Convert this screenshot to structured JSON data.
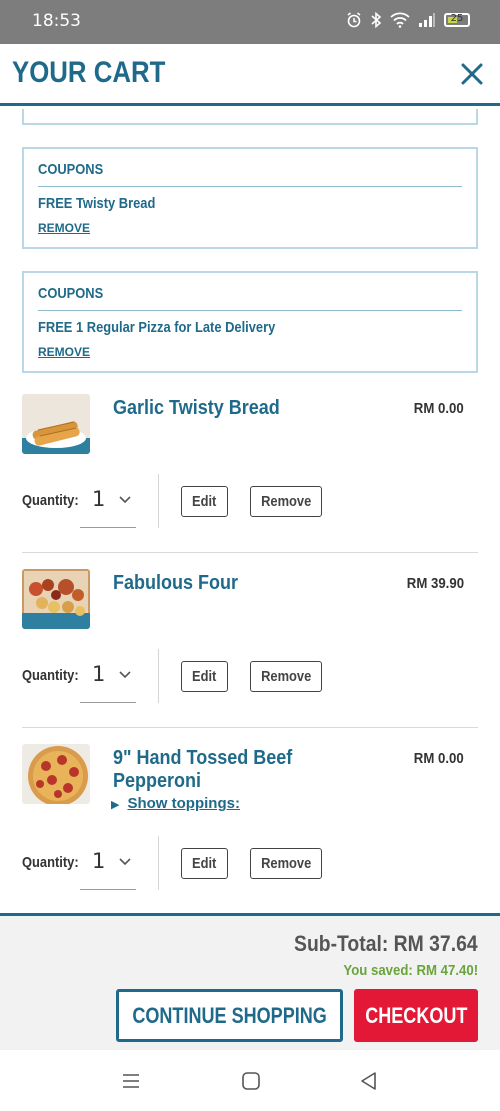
{
  "status_bar": {
    "time": "18:53",
    "battery": "25",
    "icons": [
      "alarm-icon",
      "bluetooth-icon",
      "wifi-icon",
      "signal-icon",
      "battery-icon"
    ]
  },
  "header": {
    "title": "YOUR CART",
    "close_icon": "close-icon"
  },
  "coupons": [
    {
      "title": "COUPONS",
      "description": "FREE Twisty Bread",
      "remove_label": "REMOVE"
    },
    {
      "title": "COUPONS",
      "description": "FREE 1 Regular Pizza for Late Delivery",
      "remove_label": "REMOVE"
    }
  ],
  "items": [
    {
      "name": "Garlic Twisty Bread",
      "price": "RM 0.00",
      "quantity_label": "Quantity:",
      "quantity": "1",
      "edit_label": "Edit",
      "remove_label": "Remove"
    },
    {
      "name": "Fabulous Four",
      "price": "RM 39.90",
      "quantity_label": "Quantity:",
      "quantity": "1",
      "edit_label": "Edit",
      "remove_label": "Remove"
    },
    {
      "name": "9\" Hand Tossed Beef Pepperoni",
      "price": "RM 0.00",
      "toppings_label": "Show toppings:",
      "quantity_label": "Quantity:",
      "quantity": "1",
      "edit_label": "Edit",
      "remove_label": "Remove"
    }
  ],
  "footer": {
    "subtotal": "Sub-Total: RM 37.64",
    "saved": "You saved: RM 47.40!",
    "continue_label": "CONTINUE SHOPPING",
    "checkout_label": "CHECKOUT"
  },
  "colors": {
    "brand_blue": "#1f6a8a",
    "checkout_red": "#e31837",
    "saved_green": "#6aa43c"
  },
  "nav_bar": {
    "icons": [
      "menu-icon",
      "home-icon",
      "back-icon"
    ]
  }
}
